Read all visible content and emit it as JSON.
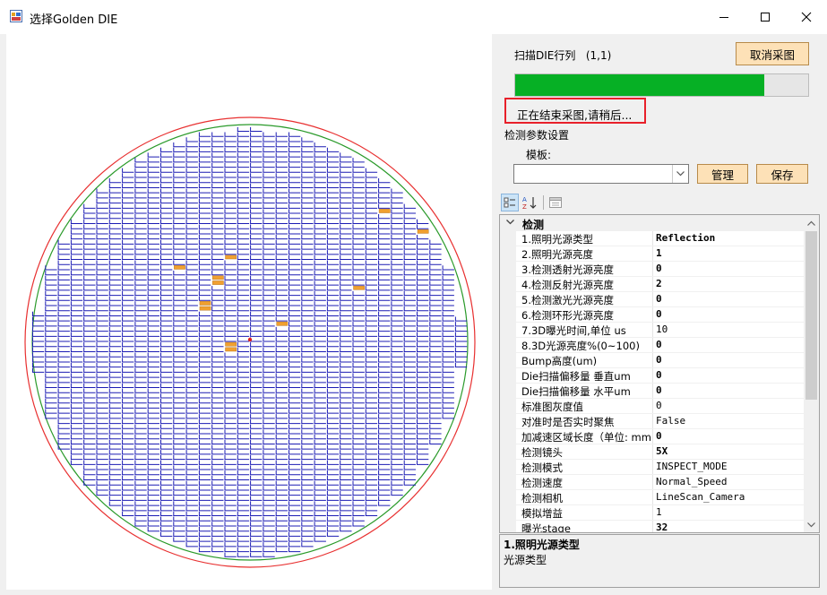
{
  "window": {
    "title": "选择Golden DIE",
    "icon": "app-window-icon",
    "controls": [
      "minimize-icon",
      "maximize-icon",
      "close-icon"
    ]
  },
  "scan": {
    "label": "扫描DIE行列",
    "position": "(1,1)",
    "cancel_label": "取消采图",
    "progress": 0.85,
    "status": "正在结束采图,请稍后..."
  },
  "settings": {
    "group_label": "检测参数设置",
    "template_label": "模板:",
    "template_value": "",
    "manage_label": "管理",
    "save_label": "保存"
  },
  "toolbar": {
    "icons": [
      "categorized-icon",
      "alphabetical-sort-icon",
      "property-pages-icon"
    ]
  },
  "property_grid": {
    "category": "检测",
    "rows": [
      {
        "name": "1.照明光源类型",
        "value": "Reflection",
        "bold": true
      },
      {
        "name": "2.照明光源亮度",
        "value": "1",
        "bold": true
      },
      {
        "name": "3.检测透射光源亮度",
        "value": "0",
        "bold": true
      },
      {
        "name": "4.检测反射光源亮度",
        "value": "2",
        "bold": true
      },
      {
        "name": "5.检测激光光源亮度",
        "value": "0",
        "bold": true
      },
      {
        "name": "6.检测环形光源亮度",
        "value": "0",
        "bold": true
      },
      {
        "name": "7.3D曝光时间,单位 us",
        "value": "10",
        "bold": false
      },
      {
        "name": "8.3D光源亮度%(0~100)",
        "value": "0",
        "bold": true
      },
      {
        "name": "Bump高度(um)",
        "value": "0",
        "bold": true
      },
      {
        "name": "Die扫描偏移量  垂直um",
        "value": "0",
        "bold": true
      },
      {
        "name": "Die扫描偏移量  水平um",
        "value": "0",
        "bold": true
      },
      {
        "name": "标准图灰度值",
        "value": "0",
        "bold": false
      },
      {
        "name": "对准时是否实时聚焦",
        "value": "False",
        "bold": false
      },
      {
        "name": "加减速区域长度（单位: mm",
        "value": "0",
        "bold": true
      },
      {
        "name": "检测镜头",
        "value": "5X",
        "bold": true
      },
      {
        "name": "检测模式",
        "value": "INSPECT_MODE",
        "bold": false
      },
      {
        "name": "检测速度",
        "value": "Normal_Speed",
        "bold": false
      },
      {
        "name": "检测相机",
        "value": "LineScan_Camera",
        "bold": false
      },
      {
        "name": "模拟增益",
        "value": "1",
        "bold": false
      },
      {
        "name": "曝光stage",
        "value": "32",
        "bold": true
      }
    ]
  },
  "description": {
    "title": "1.照明光源类型",
    "text": "光源类型"
  },
  "colors": {
    "die": "#1c1cb4",
    "golden_die": "#f0a030",
    "outer_ring": "#e83030",
    "inner_ring": "#2a9a2a",
    "center_mark": "#e02020",
    "progress": "#06b025",
    "status_border": "#e8202a"
  }
}
